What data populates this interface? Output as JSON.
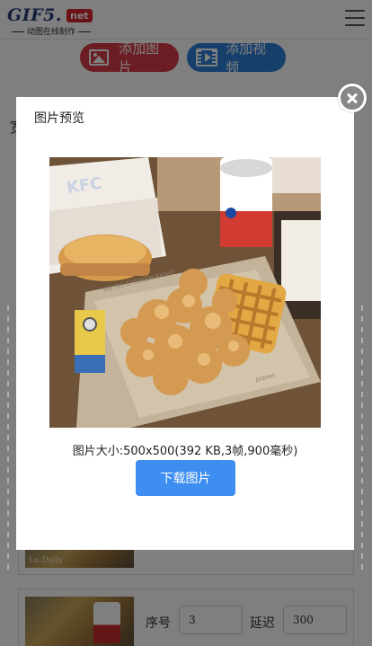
{
  "header": {
    "logo_main": "GIF5.",
    "logo_badge": "net",
    "logo_subtitle": "动图在线制作",
    "menu_icon": "hamburger-icon"
  },
  "actions": {
    "add_image_label": "添加图片",
    "add_image_icon": "image-icon",
    "add_image_color": "#d63a47",
    "add_video_label": "添加视频",
    "add_video_icon": "film-icon",
    "add_video_color": "#2d7ed6"
  },
  "background": {
    "partial_text": "宽"
  },
  "modal": {
    "title": "图片预览",
    "close_icon": "close-icon",
    "image_info": "图片大小:500x500(392 KB,3帧,900毫秒)",
    "download_label": "下载图片",
    "download_color": "#3d8ef0"
  },
  "frames": [
    {
      "thumb_label": "Lu.Dally"
    },
    {
      "index_label": "序号",
      "index_value": "3",
      "delay_label": "延迟",
      "delay_value": "300"
    }
  ]
}
